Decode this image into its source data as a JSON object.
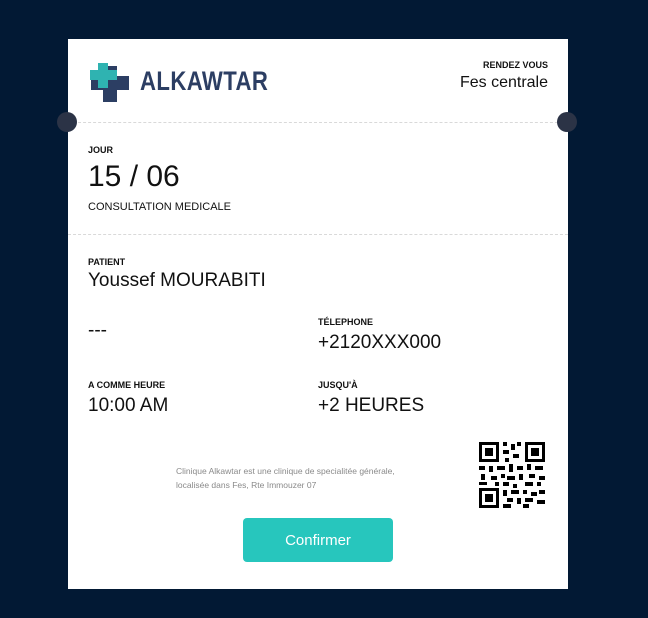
{
  "brand": {
    "name": "ALKAWTAR"
  },
  "rendezvous": {
    "label": "RENDEZ VOUS",
    "location": "Fes centrale"
  },
  "jour": {
    "label": "JOUR",
    "date": "15 / 06",
    "type": "CONSULTATION MEDICALE"
  },
  "patient": {
    "label": "PATIENT",
    "name": "Youssef MOURABITI",
    "field": "---",
    "telephone_label": "TÉLEPHONE",
    "telephone": "+2120XXX000"
  },
  "schedule": {
    "heure_label": "A COMME HEURE",
    "heure": "10:00 AM",
    "jusqu_label": "JUSQU'À",
    "jusqu": "+2 HEURES"
  },
  "info": {
    "line1": "Clinique Alkawtar est une clinique de specialitée générale,",
    "line2": "localisée dans Fes, Rte Immouzer 07"
  },
  "actions": {
    "confirm_label": "Confirmer"
  },
  "colors": {
    "background": "#021934",
    "accent": "#27c6bd",
    "brand_dark": "#2c3e63",
    "brand_teal": "#2fb3b1"
  }
}
